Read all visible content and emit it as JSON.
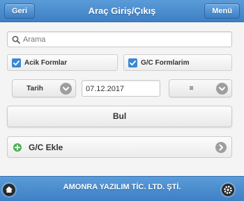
{
  "header": {
    "title": "Araç Giriş/Çıkış",
    "back_label": "Geri",
    "menu_label": "Menü"
  },
  "search": {
    "placeholder": "Arama",
    "value": "",
    "icon": "search-icon"
  },
  "filters": {
    "open_forms_label": "Acik Formlar",
    "open_forms_checked": true,
    "my_forms_label": "G/C Formlarim",
    "my_forms_checked": true
  },
  "date_filter": {
    "field_label": "Tarih",
    "date_value": "07.12.2017",
    "operator_label": "="
  },
  "find_button": {
    "label": "Bul"
  },
  "list": [
    {
      "label": "G/C Ekle",
      "icon": "plus-icon"
    }
  ],
  "footer": {
    "text": "AMONRA YAZILIM TİC. LTD. ŞTİ.",
    "home_icon": "home-icon",
    "settings_icon": "gear-icon"
  },
  "colors": {
    "header_bg": "#4a8fd0",
    "checkbox_checked": "#3a88d5",
    "add_icon": "#47b24c"
  }
}
